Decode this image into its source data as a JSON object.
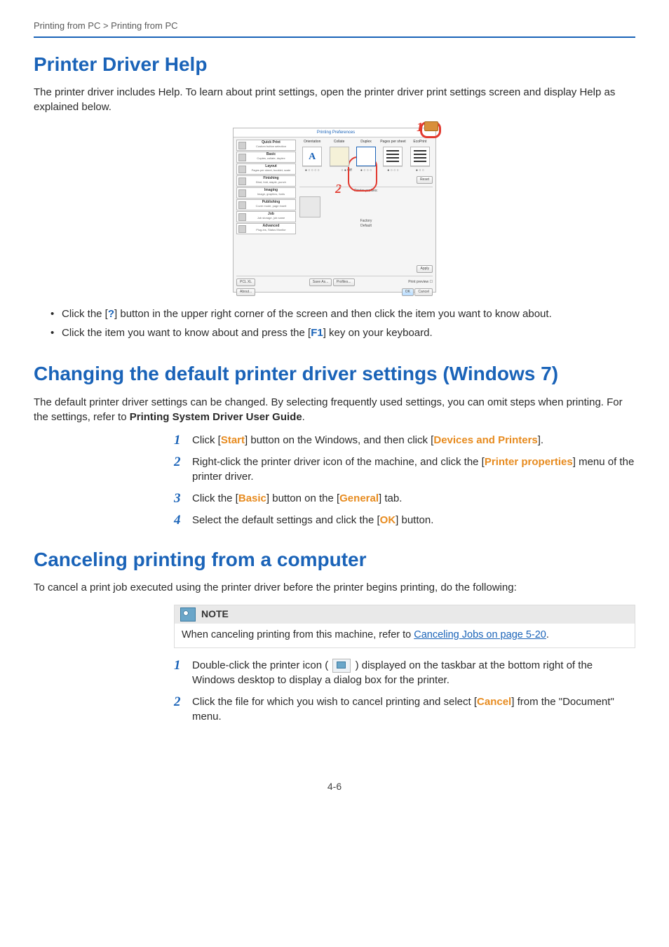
{
  "breadcrumb": "Printing from PC > Printing from PC",
  "sections": {
    "help": {
      "title": "Printer Driver Help",
      "body": "The printer driver includes Help. To learn about print settings, open the printer driver print settings screen and display Help as explained below.",
      "screenshot": {
        "window_title": "Printing Preferences",
        "sidebar": [
          {
            "title": "Quick Print",
            "sub": "Custom button selection"
          },
          {
            "title": "Basic",
            "sub": "Copies, collate, duplex"
          },
          {
            "title": "Layout",
            "sub": "Pages per sheet, booklet, scale"
          },
          {
            "title": "Finishing",
            "sub": "Bind, fold, staple, punch"
          },
          {
            "title": "Imaging",
            "sub": "Image, graphics, fonts"
          },
          {
            "title": "Publishing",
            "sub": "Cover mode, page insert"
          },
          {
            "title": "Job",
            "sub": "Job storage, job name"
          },
          {
            "title": "Advanced",
            "sub": "Plug-ins, Status Monitor"
          }
        ],
        "options": [
          "Orientation",
          "Collate",
          "Duplex",
          "Pages per sheet",
          "EcoPrint"
        ],
        "profiles_label": "Printer profiles:",
        "profile_btn1": "Factory",
        "profile_btn2": "Default",
        "btn_reset": "Reset",
        "btn_apply": "Apply",
        "btn_pcl": "PCL XL",
        "btn_saveas": "Save As...",
        "btn_profiles": "Profiles...",
        "btn_about": "About...",
        "chk_preview": "Print preview",
        "btn_ok": "OK",
        "btn_cancel": "Cancel",
        "callouts": {
          "one": "1",
          "two": "2"
        }
      },
      "bullets": {
        "b1_pre": "Click the [",
        "b1_key": "?",
        "b1_post": "] button in the upper right corner of the screen and then click the item you want to know about.",
        "b2_pre": "Click the item you want to know about and press the [",
        "b2_key": "F1",
        "b2_post": "] key on your keyboard."
      }
    },
    "defaults": {
      "title": "Changing the default printer driver settings (Windows 7)",
      "body_pre": "The default printer driver settings can be changed. By selecting frequently used settings, you can omit steps when printing. For the settings, refer to ",
      "body_strong": "Printing System Driver User Guide",
      "body_post": ".",
      "steps": {
        "s1": {
          "a": "Click [",
          "b": "Start",
          "c": "] button on the Windows, and then click [",
          "d": "Devices and Printers",
          "e": "]."
        },
        "s2": {
          "a": "Right-click the printer driver icon of the machine, and click the [",
          "b": "Printer properties",
          "c": "] menu of the printer driver."
        },
        "s3": {
          "a": "Click the [",
          "b": "Basic",
          "c": "] button on the [",
          "d": "General",
          "e": "] tab."
        },
        "s4": {
          "a": "Select the default settings and click the [",
          "b": "OK",
          "c": "] button."
        }
      }
    },
    "cancel": {
      "title": "Canceling printing from a computer",
      "body": "To cancel a print job executed using the printer driver before the printer begins printing, do the following:",
      "note": {
        "label": "NOTE",
        "pre": "When canceling printing from this machine, refer to ",
        "link": "Canceling Jobs on page 5-20",
        "post": "."
      },
      "steps": {
        "s1": {
          "a": "Double-click the printer icon ( ",
          "b": " ) displayed on the taskbar at the bottom right of the Windows desktop to display a dialog box for the printer."
        },
        "s2": {
          "a": "Click the file for which you wish to cancel printing and select [",
          "b": "Cancel",
          "c": "] from the \"Document\" menu."
        }
      }
    }
  },
  "page_number": "4-6"
}
